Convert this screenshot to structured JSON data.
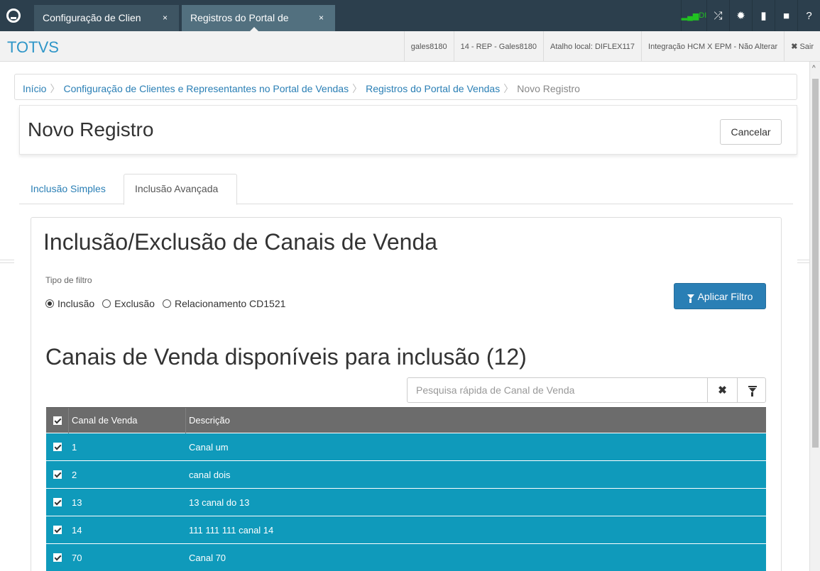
{
  "topbar": {
    "tabs": [
      {
        "label": "Configuração de Clien",
        "close": "×"
      },
      {
        "label": "Registros do Portal de",
        "close": "×"
      }
    ],
    "signal_label": "DI"
  },
  "subbar": {
    "brand": "TOTVS",
    "info": [
      "gales8180",
      "14 - REP - Gales8180",
      "Atalho local: DIFLEX117",
      "Integração HCM X EPM - Não Alterar"
    ],
    "logout_label": "Sair"
  },
  "breadcrumb": {
    "items": [
      "Início",
      "Configuração de Clientes e Representantes no Portal de Vendas",
      "Registros do Portal de Vendas"
    ],
    "current": "Novo Registro"
  },
  "header": {
    "title": "Novo Registro",
    "cancel_label": "Cancelar"
  },
  "tabs": {
    "simple": "Inclusão Simples",
    "advanced": "Inclusão Avançada"
  },
  "section": {
    "title": "Inclusão/Exclusão de Canais de Venda",
    "filter_type_label": "Tipo de filtro",
    "radio_options": [
      "Inclusão",
      "Exclusão",
      "Relacionamento CD1521"
    ],
    "selected_option": "Inclusão",
    "apply_label": "Aplicar Filtro"
  },
  "list": {
    "title": "Canais de Venda disponíveis para inclusão (12)",
    "search_placeholder": "Pesquisa rápida de Canal de Venda",
    "columns": [
      "Canal de Venda",
      "Descrição"
    ],
    "rows": [
      {
        "code": "1",
        "desc": "Canal um"
      },
      {
        "code": "2",
        "desc": "canal dois"
      },
      {
        "code": "13",
        "desc": "13 canal do 13"
      },
      {
        "code": "14",
        "desc": "111 111 111 canal 14"
      },
      {
        "code": "70",
        "desc": "Canal 70"
      }
    ]
  },
  "colors": {
    "topbar": "#2c3f4d",
    "accent": "#2a7fb5",
    "row_selected": "#0f9abb",
    "grid_header": "#6c6c6c"
  }
}
